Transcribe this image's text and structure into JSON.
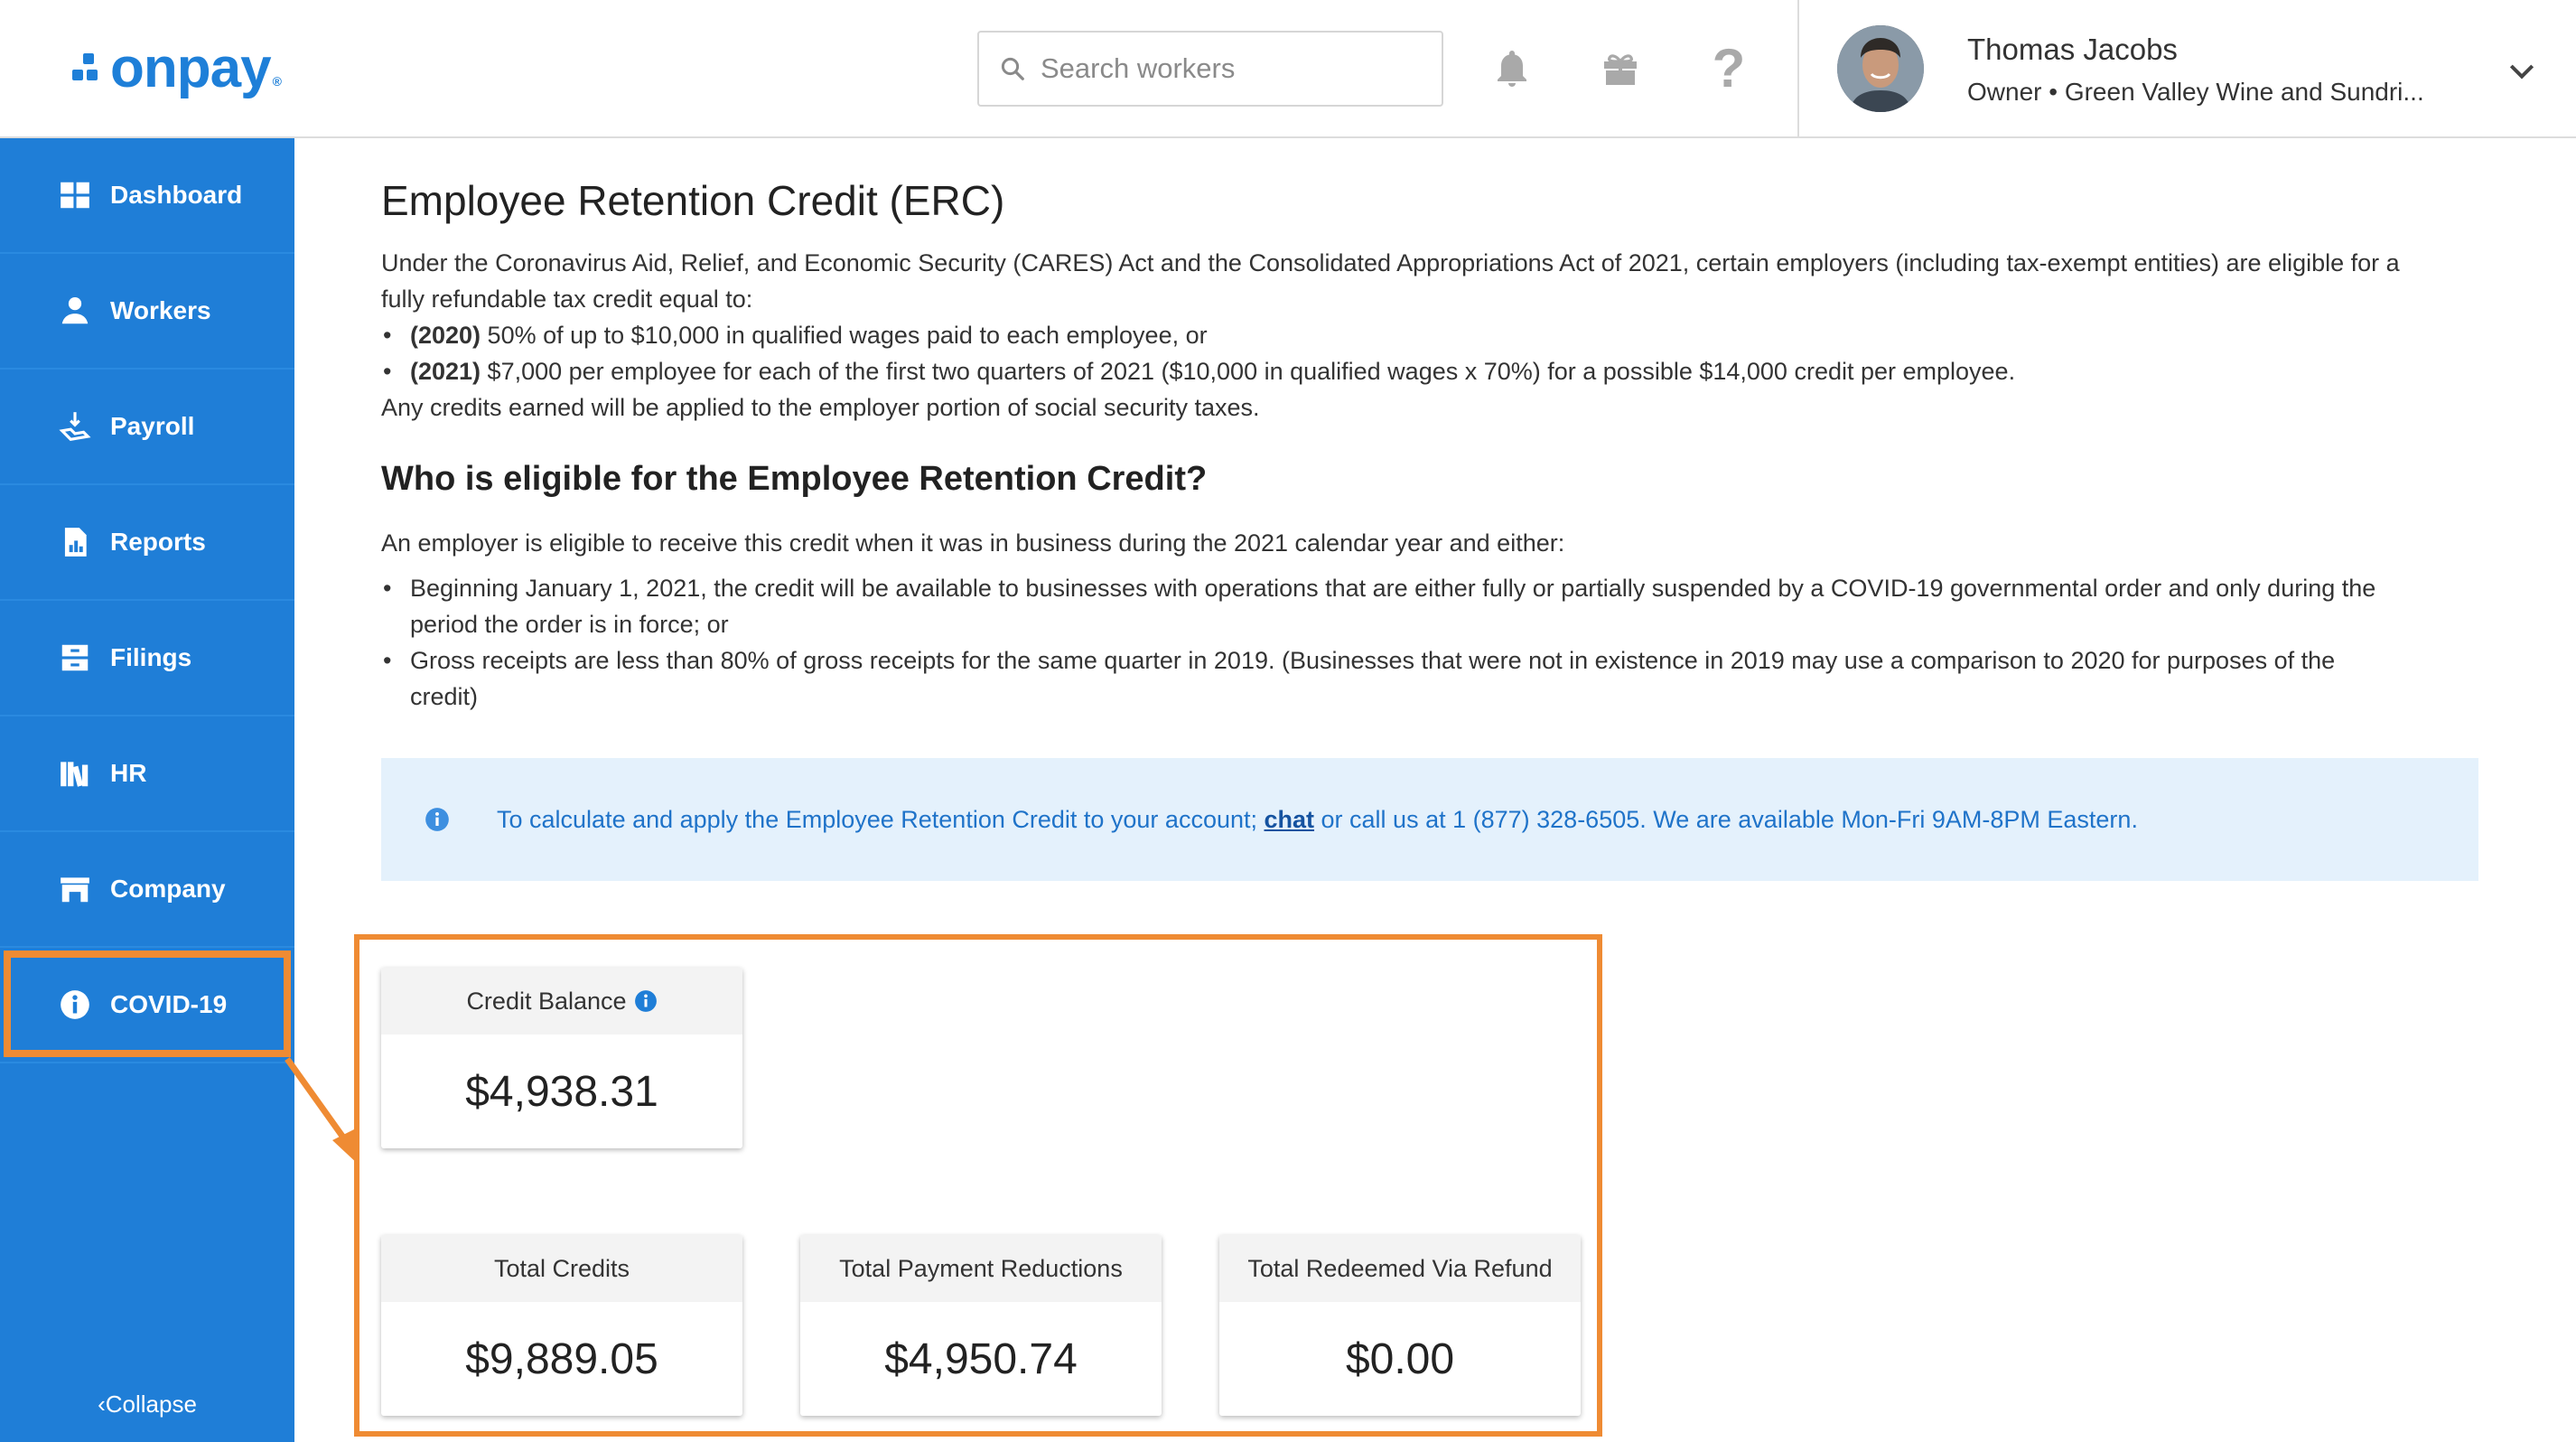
{
  "app": {
    "logo_text": "onpay",
    "logo_reg": "®",
    "brand_color": "#1f7ed7",
    "highlight_color": "#ef8b33"
  },
  "header": {
    "search_placeholder": "Search workers",
    "icons": [
      "bell-icon",
      "gift-icon",
      "help-icon"
    ],
    "help_glyph": "?",
    "user": {
      "name": "Thomas Jacobs",
      "role": "Owner • Green Valley Wine and Sundri..."
    }
  },
  "sidebar": {
    "items": [
      {
        "label": "Dashboard",
        "icon": "dashboard-icon"
      },
      {
        "label": "Workers",
        "icon": "workers-icon"
      },
      {
        "label": "Payroll",
        "icon": "payroll-icon"
      },
      {
        "label": "Reports",
        "icon": "reports-icon"
      },
      {
        "label": "Filings",
        "icon": "filings-icon"
      },
      {
        "label": "HR",
        "icon": "hr-icon"
      },
      {
        "label": "Company",
        "icon": "company-icon"
      },
      {
        "label": "COVID-19",
        "icon": "info-icon",
        "active": true
      }
    ],
    "collapse_label": "Collapse"
  },
  "main": {
    "title": "Employee Retention Credit (ERC)",
    "intro_line1": "Under the Coronavirus Aid, Relief, and Economic Security (CARES) Act and the Consolidated Appropriations Act of 2021, certain employers (including tax-exempt entities) are eligible for a",
    "intro_line2": "fully refundable tax credit equal to:",
    "bullets_top": [
      {
        "bold": "(2020)",
        "text": " 50% of up to $10,000 in qualified wages paid to each employee, or"
      },
      {
        "bold": "(2021)",
        "text": " $7,000 per employee for each of the first two quarters of 2021 ($10,000 in qualified wages x 70%) for a possible $14,000 credit per employee."
      }
    ],
    "intro_line3": "Any credits earned will be applied to the employer portion of social security taxes.",
    "eligible_heading": "Who is eligible for the Employee Retention Credit?",
    "eligible_intro": "An employer is eligible to receive this credit when it was in business during the 2021 calendar year and either:",
    "eligible_bullets": [
      {
        "line1": "Beginning January 1, 2021, the credit will be available to businesses with operations that are either fully or partially suspended by a COVID-19 governmental order and only during the",
        "line2": "period the order is in force; or"
      },
      {
        "line1": "Gross receipts are less than 80% of gross receipts for the same quarter in 2019. (Businesses that were not in existence in 2019 may use a comparison to 2020 for purposes of the",
        "line2": "credit)"
      }
    ],
    "info_banner": {
      "before": "To calculate and apply the Employee Retention Credit to your account; ",
      "link": "chat",
      "after": " or call us at 1 (877) 328-6505. We are available Mon-Fri 9AM-8PM Eastern."
    },
    "cards": {
      "credit_balance": {
        "label": "Credit Balance",
        "value": "$4,938.31"
      },
      "total_credits": {
        "label": "Total Credits",
        "value": "$9,889.05"
      },
      "total_payment_reductions": {
        "label": "Total Payment Reductions",
        "value": "$4,950.74"
      },
      "total_redeemed_via_refund": {
        "label": "Total Redeemed Via Refund",
        "value": "$0.00"
      }
    }
  }
}
